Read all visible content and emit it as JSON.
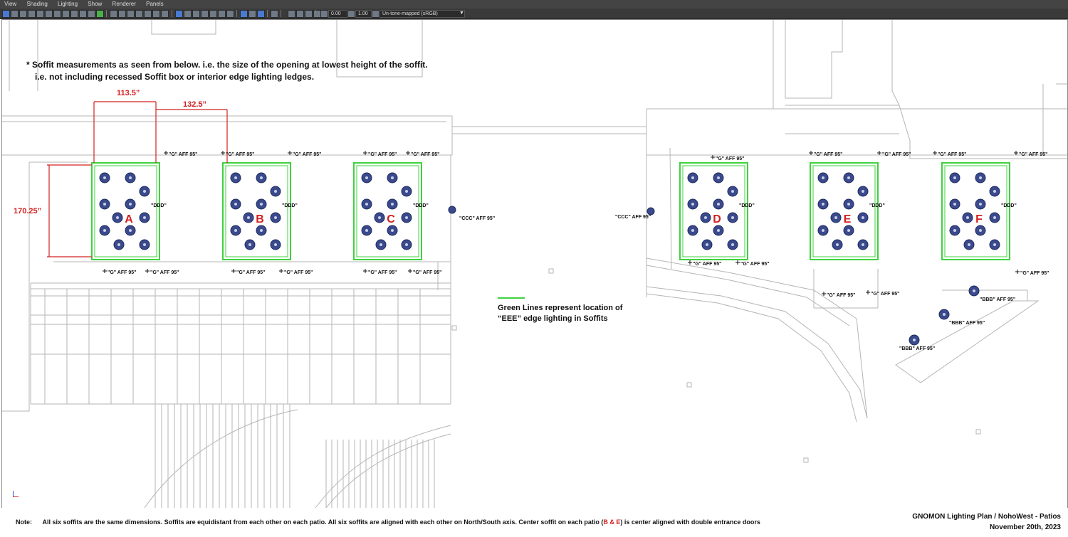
{
  "menu": {
    "items": [
      "View",
      "Shading",
      "Lighting",
      "Show",
      "Renderer",
      "Panels"
    ]
  },
  "toolbar": {
    "exposure_value": "0.00",
    "gamma_value": "1.00",
    "color_space": "Un-tone-mapped (sRGB)"
  },
  "notes": {
    "line1": "* Soffit measurements as seen from below. i.e. the size of the opening at lowest height of the soffit.",
    "line2": "i.e. not including recessed Soffit box or interior edge lighting ledges.",
    "dim_width": "113.5”",
    "dim_spacing": "132.5”",
    "dim_height": "170.25”",
    "legend_line1": "Green Lines represent location of",
    "legend_line2": "“EEE” edge lighting in Soffits"
  },
  "labels": {
    "g": "\"G\" AFF 95\"",
    "ddd": "\"DDD\"",
    "ccc": "\"CCC\" AFF 95\"",
    "bbb": "\"BBB\" AFF 95\""
  },
  "soffits": [
    {
      "letter": "A"
    },
    {
      "letter": "B"
    },
    {
      "letter": "C"
    },
    {
      "letter": "D"
    },
    {
      "letter": "E"
    },
    {
      "letter": "F"
    }
  ],
  "footer": {
    "note_prefix": "Note:",
    "note_text": "All six soffits are the same dimensions. Soffits are equidistant from each other on each patio.   All six soffits are aligned with each other on North/South axis. Center soffit on each patio (",
    "note_highlight": "B & E",
    "note_suffix": ") is center aligned with double entrance doors",
    "title": "GNOMON Lighting Plan / NohoWest - Patios",
    "date": "November 20th, 2023"
  },
  "colors": {
    "soffit_edge": "#3fd23f",
    "fixture": "#3a4a8c",
    "accent_red": "#d22020",
    "line": "#b5b5b5"
  },
  "icons": [
    "select-tool-icon",
    "camera-icon",
    "light-icon",
    "grid-icon",
    "wireframe-icon",
    "shaded-icon",
    "textured-icon",
    "exposure-icon",
    "gamma-icon",
    "colorspace-icon"
  ]
}
